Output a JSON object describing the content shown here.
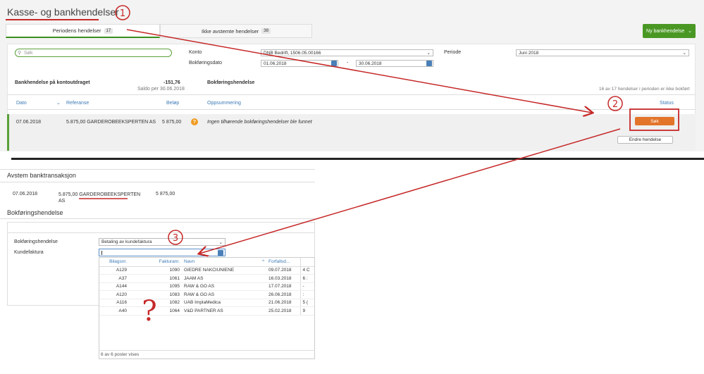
{
  "top": {
    "title": "Kasse- og bankhendelser",
    "tabs": [
      {
        "label": "Periodens hendelser",
        "count": "17"
      },
      {
        "label": "Ikke avstemte hendelser",
        "count": "38"
      }
    ],
    "new_button": "Ny bankhendelse",
    "search_placeholder": "Søk",
    "konto_label": "Konto",
    "konto_value": "DNB Bedrift, 1506.05.00166",
    "bokforingsdato_label": "Bokføringsdato",
    "date_from": "01.06.2018",
    "date_dash": "-",
    "date_to": "30.06.2018",
    "periode_label": "Periode",
    "periode_value": "Juni 2018",
    "bank_section_label": "Bankhendelse på kontoutdraget",
    "saldo_amount": "-151,76",
    "saldo_label": "Saldo per 30.06.2018",
    "bokf_section_label": "Bokføringshendelse",
    "summary_text": "16 av 17 hendelser i perioden er ikke bokført",
    "columns": {
      "dato": "Dato",
      "referanse": "Referanse",
      "belop": "Beløp",
      "oppsummering": "Oppsummering",
      "status": "Status"
    },
    "row": {
      "date": "07.06.2018",
      "reference": "5.875,00 GARDEROBEEKSPERTEN AS",
      "amount": "5 875,00",
      "status_icon": "?",
      "summary": "Ingen tilhørende bokføringshendelser ble funnet",
      "search_button": "Søk",
      "edit_button": "Endre hendelse"
    }
  },
  "lower": {
    "title": "Avstem banktransaksjon",
    "txn_date": "07.06.2018",
    "txn_ref_line1": "5.875,00 GARDEROBEEKSPERTEN",
    "txn_ref_line2": "AS",
    "txn_amount": "5 875,00",
    "bokf_title": "Bokføringshendelse",
    "bokf_label": "Bokføringshendelse",
    "bokf_value": "Betaling av kundefaktura",
    "kunde_label": "Kundefaktura",
    "table_headers": {
      "bilagsnr": "Bilagsnr.",
      "fakturanr": "Fakturanr.",
      "navn": "Navn",
      "forfall": "Forfallsd..."
    },
    "rows": [
      {
        "bilag": "A129",
        "faktura": "1090",
        "navn": "GIEDRE NAKCIUNIENE",
        "forfall": "09.07.2018",
        "extra": "4 C"
      },
      {
        "bilag": "A37",
        "faktura": "1061",
        "navn": "JAAM AS",
        "forfall": "16.03.2018",
        "extra": "6 :"
      },
      {
        "bilag": "A144",
        "faktura": "1095",
        "navn": "RAW & GO AS",
        "forfall": "17.07.2018",
        "extra": "-"
      },
      {
        "bilag": "A120",
        "faktura": "1083",
        "navn": "RAW & GO AS",
        "forfall": "26.06.2018",
        "extra": ":"
      },
      {
        "bilag": "A116",
        "faktura": "1082",
        "navn": "UAB ImplaMedica",
        "forfall": "21.06.2018",
        "extra": "5 ("
      },
      {
        "bilag": "A40",
        "faktura": "1064",
        "navn": "V&D PARTNER AS",
        "forfall": "25.02.2018",
        "extra": "9"
      }
    ],
    "footer": "6 av 6 poster vises"
  },
  "annotations": {
    "one": "1",
    "two": "2",
    "three": "3",
    "question": "?"
  },
  "colors": {
    "accent_green": "#4a9824",
    "orange": "#e2752a",
    "annotation_red": "#c62828",
    "link_blue": "#3d7ab6"
  }
}
